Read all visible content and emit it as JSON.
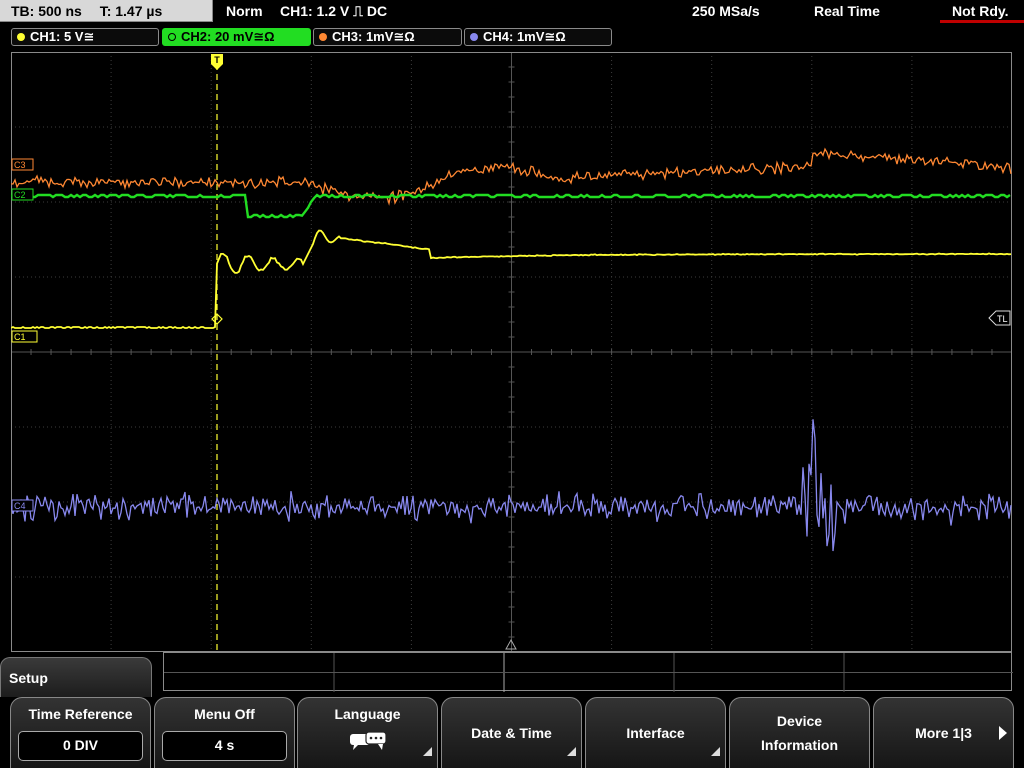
{
  "status": {
    "timebase": "TB: 500 ns",
    "trigger_time": "T: 1.47 µs",
    "mode": "Norm",
    "trigger_source": "CH1: 1.2 V ⎍ DC",
    "sample_rate": "250 MSa/s",
    "acquisition": "Real Time",
    "state": "Not Rdy."
  },
  "channels": [
    {
      "label": "CH1: 5 V≅",
      "color": "#ffff33",
      "active": false
    },
    {
      "label": "CH2: 20 mV≅Ω",
      "color": "#22dd22",
      "active": true
    },
    {
      "label": "CH3: 1mV≅Ω",
      "color": "#ff8833",
      "active": false
    },
    {
      "label": "CH4: 1mV≅Ω",
      "color": "#8888ee",
      "active": false
    }
  ],
  "screen": {
    "markers": {
      "c1": "C1",
      "c2": "C2",
      "c3": "C3",
      "c4": "C4",
      "trigger_level": "TL",
      "trigger_point": "T"
    },
    "grid_color": "#3c3c3c"
  },
  "menu": {
    "tab": "Setup",
    "keys": {
      "time_reference": {
        "label": "Time Reference",
        "value": "0 DIV"
      },
      "menu_off": {
        "label": "Menu Off",
        "value": "4 s"
      },
      "language": {
        "label": "Language",
        "icon": "speech-bubbles-icon"
      },
      "date_time": {
        "label": "Date & Time"
      },
      "interface": {
        "label": "Interface"
      },
      "device_info": {
        "line1": "Device",
        "line2": "Information"
      },
      "more": {
        "label": "More 1|3"
      }
    }
  }
}
